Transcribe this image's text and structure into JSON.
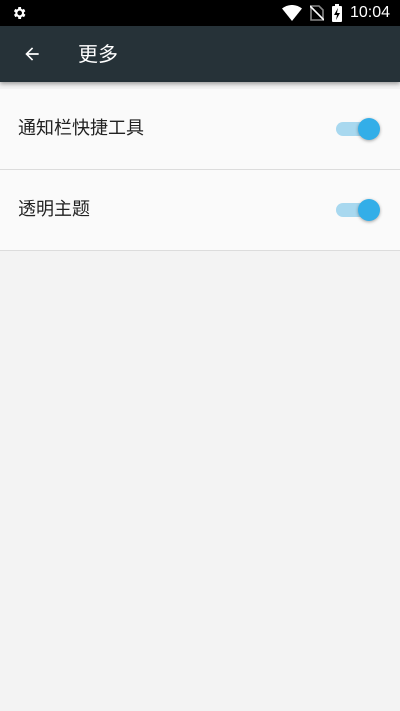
{
  "status_bar": {
    "time": "10:04",
    "icons": [
      "settings-gear-icon",
      "wifi-icon",
      "no-sim-icon",
      "battery-charging-icon"
    ]
  },
  "app_bar": {
    "back_icon": "arrow-back-icon",
    "title": "更多"
  },
  "settings": {
    "items": [
      {
        "label": "通知栏快捷工具",
        "enabled": true
      },
      {
        "label": "透明主题",
        "enabled": true
      }
    ]
  },
  "colors": {
    "app_bar": "#263238",
    "toggle_on": "#33aee8",
    "toggle_track_on": "#a8d8ef",
    "background": "#f3f3f3"
  }
}
